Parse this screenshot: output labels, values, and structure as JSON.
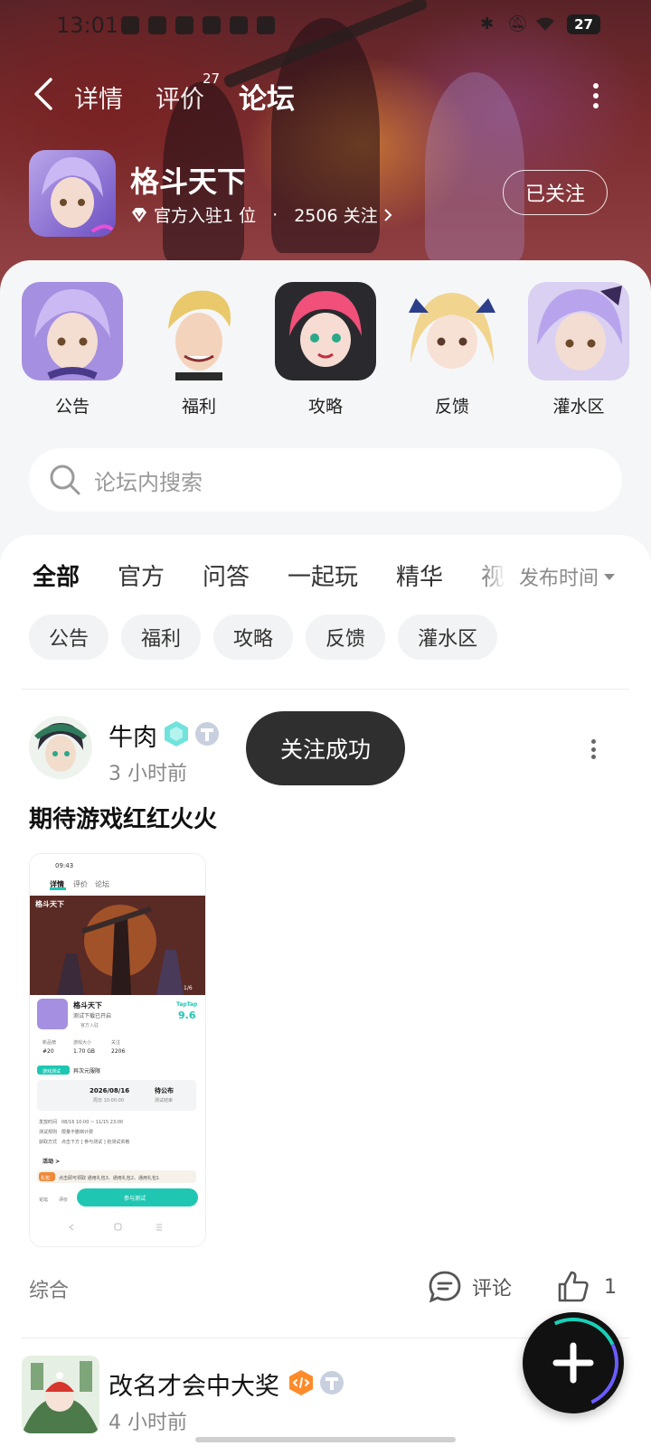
{
  "status_bar": {
    "time": "13:01",
    "battery": "27"
  },
  "nav": {
    "tabs": [
      {
        "label": "详情"
      },
      {
        "label": "评价",
        "badge": "27"
      },
      {
        "label": "论坛"
      }
    ]
  },
  "game": {
    "name": "格斗天下",
    "meta_official": "官方入驻1 位",
    "meta_separator": "·",
    "meta_follow": "2506 关注",
    "follow_button": "已关注"
  },
  "boards": [
    {
      "label": "公告"
    },
    {
      "label": "福利"
    },
    {
      "label": "攻略"
    },
    {
      "label": "反馈"
    },
    {
      "label": "灌水区"
    }
  ],
  "search": {
    "placeholder": "论坛内搜索"
  },
  "tabs": [
    {
      "label": "全部"
    },
    {
      "label": "官方"
    },
    {
      "label": "问答"
    },
    {
      "label": "一起玩"
    },
    {
      "label": "精华"
    },
    {
      "label": "视"
    }
  ],
  "sort_label": "发布时间",
  "chips": [
    {
      "label": "公告"
    },
    {
      "label": "福利"
    },
    {
      "label": "攻略"
    },
    {
      "label": "反馈"
    },
    {
      "label": "灌水区"
    }
  ],
  "posts": [
    {
      "user": "牛肉",
      "time": "3 小时前",
      "title": "期待游戏红红火火",
      "category": "综合",
      "comment_label": "评论",
      "like_count": "1"
    },
    {
      "user": "改名才会中大奖",
      "time": "4 小时前"
    }
  ],
  "toast": "关注成功",
  "thumbnail": {
    "time": "09:43",
    "tabs": [
      "详情",
      "评价",
      "论坛"
    ],
    "logo": "格斗天下",
    "page": "1/6",
    "game_name": "格斗天下",
    "subtitle": "测试下载已开启",
    "official": "官方入驻",
    "score_brand": "TapTap",
    "score": "9.6",
    "stats": [
      {
        "label": "新品榜",
        "value": "#20"
      },
      {
        "label": "游戏大小",
        "value": "1.70 GB"
      },
      {
        "label": "关注",
        "value": "2206"
      }
    ],
    "test_tag": "游戏测试",
    "test_name": "异次元服限",
    "test_date": "2026/08/16",
    "test_date_sub": "周日 10:00:00",
    "test_state": "待公布",
    "test_state_sub": "测试结束",
    "info": [
      "发放时间　08/16 10:00 ~ 11/15 23:00",
      "测试规则　限量不删档计费",
      "获取方式　点击下方 [ 参与测试 ] 抢测试资格"
    ],
    "activity_title": "活动 >",
    "gift_tag": "礼包",
    "gift_text": "点击即可领取 通用礼包3、通用礼包2、通用礼包1",
    "bottom_left": "论坛",
    "bottom_mid": "评价",
    "cta": "参与测试"
  }
}
